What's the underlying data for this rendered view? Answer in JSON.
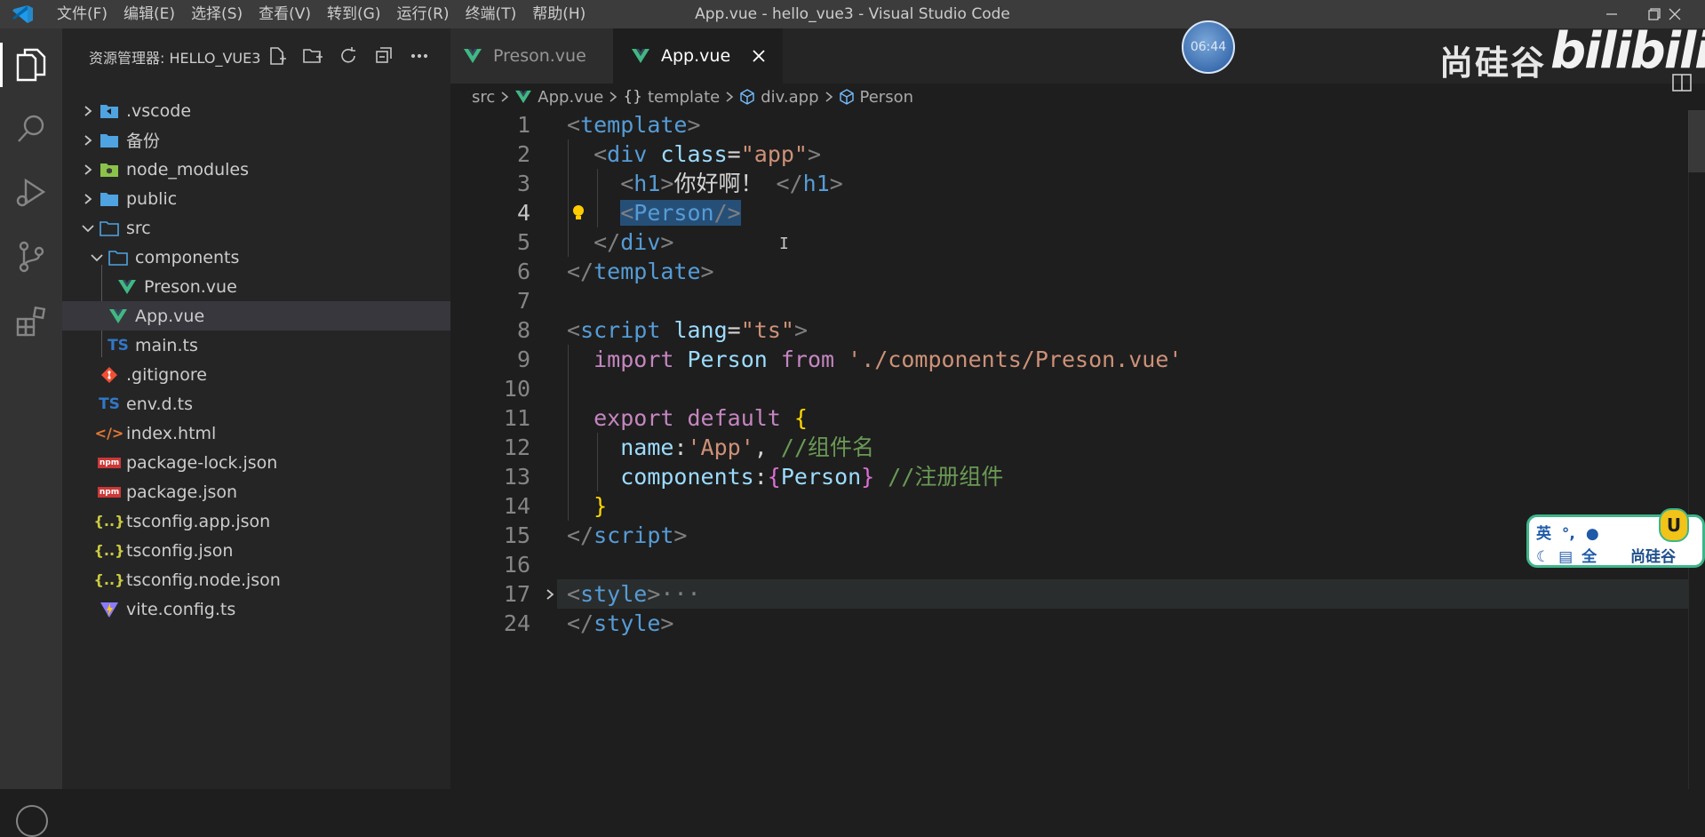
{
  "titlebar": {
    "menu": [
      "文件(F)",
      "编辑(E)",
      "选择(S)",
      "查看(V)",
      "转到(G)",
      "运行(R)",
      "终端(T)",
      "帮助(H)"
    ],
    "window_title": "App.vue - hello_vue3 - Visual Studio Code"
  },
  "sidebar": {
    "title": "资源管理器: HELLO_VUE3",
    "tree": [
      {
        "label": ".vscode",
        "icon": "vscode-folder-icon",
        "chev": "right"
      },
      {
        "label": "备份",
        "icon": "folder-icon",
        "chev": "right"
      },
      {
        "label": "node_modules",
        "icon": "node-folder-icon",
        "chev": "right"
      },
      {
        "label": "public",
        "icon": "folder-icon",
        "chev": "right"
      },
      {
        "label": "src",
        "icon": "folder-open-icon",
        "chev": "down"
      },
      {
        "label": "components",
        "icon": "folder-open-icon",
        "chev": "down"
      },
      {
        "label": "Preson.vue",
        "icon": "vue-icon"
      },
      {
        "label": "App.vue",
        "icon": "vue-icon",
        "selected": true
      },
      {
        "label": "main.ts",
        "icon": "ts-icon"
      },
      {
        "label": ".gitignore",
        "icon": "git-icon"
      },
      {
        "label": "env.d.ts",
        "icon": "ts-icon"
      },
      {
        "label": "index.html",
        "icon": "html-icon"
      },
      {
        "label": "package-lock.json",
        "icon": "npm-icon"
      },
      {
        "label": "package.json",
        "icon": "npm-icon"
      },
      {
        "label": "tsconfig.app.json",
        "icon": "json-icon"
      },
      {
        "label": "tsconfig.json",
        "icon": "json-icon"
      },
      {
        "label": "tsconfig.node.json",
        "icon": "json-icon"
      },
      {
        "label": "vite.config.ts",
        "icon": "vite-icon"
      }
    ]
  },
  "tabs": [
    {
      "label": "Preson.vue",
      "active": false
    },
    {
      "label": "App.vue",
      "active": true
    }
  ],
  "overlay": {
    "timer": "06:44",
    "brand": "尚硅谷",
    "bili": "bilibili"
  },
  "breadcrumb": [
    "src",
    "App.vue",
    "template",
    "div.app",
    "Person"
  ],
  "editor": {
    "line_numbers": [
      "1",
      "2",
      "3",
      "4",
      "5",
      "6",
      "7",
      "8",
      "9",
      "10",
      "11",
      "12",
      "13",
      "14",
      "15",
      "16",
      "17",
      "24"
    ],
    "current_line": "4",
    "code": {
      "l1": [
        "<",
        "template",
        ">"
      ],
      "l2": [
        "<",
        "div",
        "class",
        "=",
        "\"app\"",
        ">"
      ],
      "l3": [
        "<",
        "h1",
        ">",
        "你好啊！",
        "</",
        "h1",
        ">"
      ],
      "l4": [
        "<",
        "Person",
        "/>"
      ],
      "l5": [
        "</",
        "div",
        ">"
      ],
      "l6": [
        "</",
        "template",
        ">"
      ],
      "l8": [
        "<",
        "script",
        "lang",
        "=",
        "\"ts\"",
        ">"
      ],
      "l9": [
        "import",
        "Person",
        "from",
        "'./components/Preson.vue'"
      ],
      "l11": [
        "export",
        "default",
        "{"
      ],
      "l12": [
        "name",
        ":",
        "'App'",
        ",",
        "//组件名"
      ],
      "l13": [
        "components",
        ":",
        "{",
        "Person",
        "}",
        "//注册组件"
      ],
      "l14": [
        "}"
      ],
      "l15": [
        "</",
        "script",
        ">"
      ],
      "l17": [
        "<",
        "style",
        ">",
        "···"
      ],
      "l24": [
        "</",
        "style",
        ">"
      ]
    }
  },
  "ime": {
    "lang": "英",
    "punct": "°,",
    "width": "全",
    "brand": "尚硅谷",
    "logo": "U"
  },
  "colors": {
    "accent_vue": "#41b883",
    "selection": "#264f78",
    "tag": "#569cd6",
    "string": "#ce9178",
    "keyword": "#c586c0",
    "comment": "#6a9955"
  }
}
